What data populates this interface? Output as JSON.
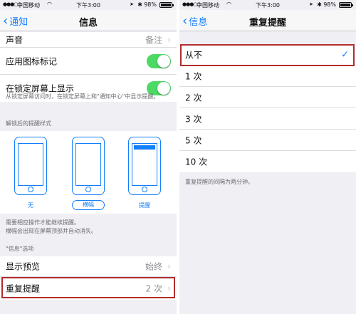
{
  "left": {
    "status": {
      "carrier": "中国移动",
      "time": "下午3:00",
      "battery": "98%",
      "battery_level": 0.98
    },
    "nav": {
      "back": "通知",
      "title": "信息"
    },
    "rows": {
      "sound": {
        "label": "声音",
        "detail": "备注"
      },
      "badge": {
        "label": "应用图标标记",
        "on": true
      },
      "lock": {
        "label": "在锁定屏幕上显示",
        "on": true
      }
    },
    "lock_note": "从锁定屏幕访问时，在锁定屏幕上和\"通知中心\"中显示提醒。",
    "style_header": "解锁后的提醒样式",
    "styles": [
      "无",
      "横幅",
      "提醒"
    ],
    "style_note_1": "需要相应操作才能继续提醒。",
    "style_note_2": "横幅会出现在屏幕顶部并自动消失。",
    "options_header": "\"信息\"选项",
    "preview": {
      "label": "显示预览",
      "detail": "始终"
    },
    "repeat": {
      "label": "重复提醒",
      "detail": "2 次"
    }
  },
  "right": {
    "status": {
      "carrier": "中国移动",
      "time": "下午3:00",
      "battery": "98%",
      "battery_level": 0.98
    },
    "nav": {
      "back": "信息",
      "title": "重复提醒"
    },
    "options": [
      "从不",
      "1 次",
      "2 次",
      "3 次",
      "5 次",
      "10 次"
    ],
    "selected": "从不",
    "footer": "重复提醒的间隔为两分钟。"
  },
  "colors": {
    "accent": "#147efb",
    "toggle_on": "#4cd964",
    "highlight": "#b32d2d"
  }
}
